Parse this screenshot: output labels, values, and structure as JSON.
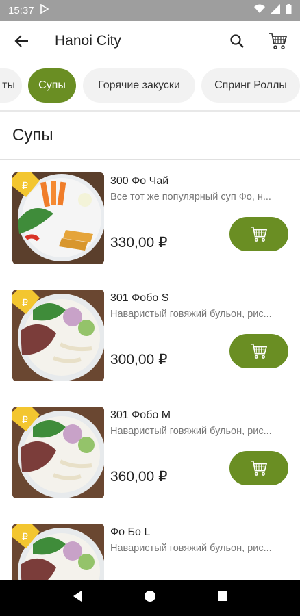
{
  "status": {
    "time": "15:37"
  },
  "header": {
    "title": "Hanoi City"
  },
  "categories": [
    "ты",
    "Супы",
    "Горячие закуски",
    "Спринг Роллы"
  ],
  "section": {
    "title": "Супы"
  },
  "items": [
    {
      "name": "300 Фо Чай",
      "description": "Все тот же популярный суп Фо, н...",
      "price": "330,00 ₽"
    },
    {
      "name": "301 Фобо S",
      "description": "Наваристый говяжий бульон, рис...",
      "price": "300,00 ₽"
    },
    {
      "name": "301 Фобо М",
      "description": "Наваристый говяжий бульон, рис...",
      "price": "360,00 ₽"
    },
    {
      "name": "Фо Бо L",
      "description": "Наваристый говяжий бульон, рис...",
      "price": ""
    }
  ],
  "colors": {
    "accent": "#6a8e23",
    "statusbar": "#9e9e9e",
    "navbar": "#000000"
  }
}
